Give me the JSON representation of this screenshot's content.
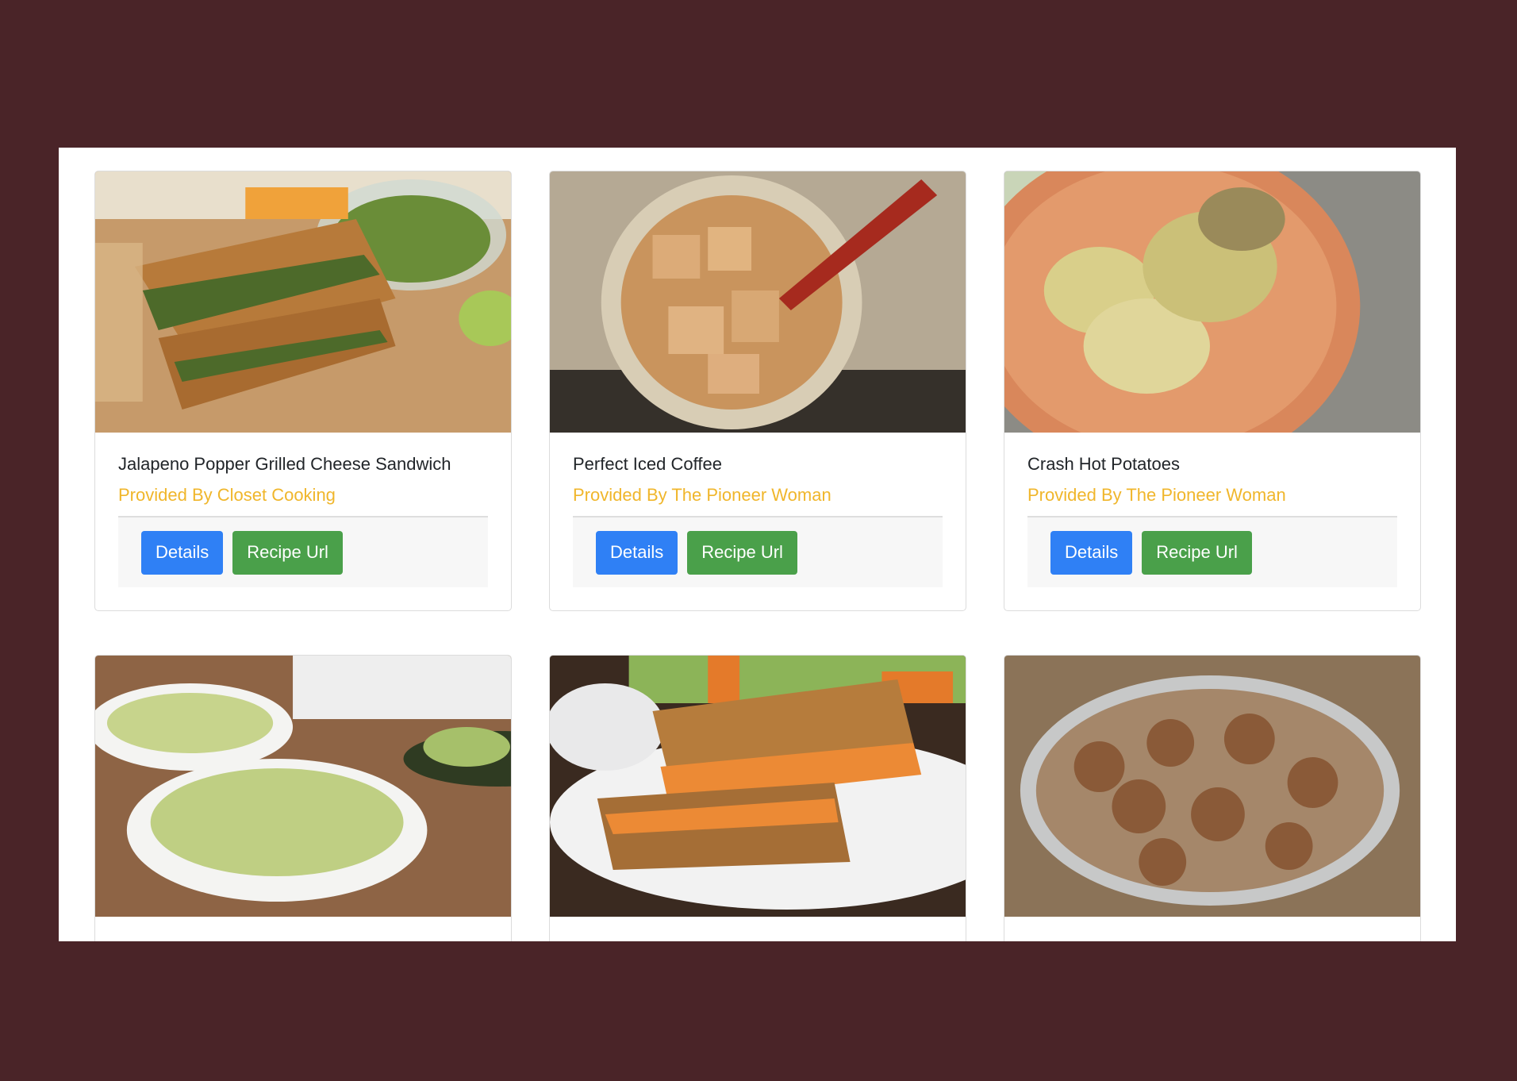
{
  "recipes": [
    {
      "title": "Jalapeno Popper Grilled Cheese Sandwich",
      "provider": "Provided By Closet Cooking",
      "details_label": "Details",
      "url_label": "Recipe Url",
      "image": "grilled-cheese-photo"
    },
    {
      "title": "Perfect Iced Coffee",
      "provider": "Provided By The Pioneer Woman",
      "details_label": "Details",
      "url_label": "Recipe Url",
      "image": "iced-coffee-photo"
    },
    {
      "title": "Crash Hot Potatoes",
      "provider": "Provided By The Pioneer Woman",
      "details_label": "Details",
      "url_label": "Recipe Url",
      "image": "potatoes-photo"
    },
    {
      "image": "avocado-pasta-photo"
    },
    {
      "image": "buffalo-grilled-cheese-photo"
    },
    {
      "image": "cinnamon-rolls-photo"
    }
  ],
  "colors": {
    "background": "#4a2428",
    "provider_text": "#f0b62b",
    "details_button": "#2f80f5",
    "recipe_url_button": "#4aa04a"
  }
}
